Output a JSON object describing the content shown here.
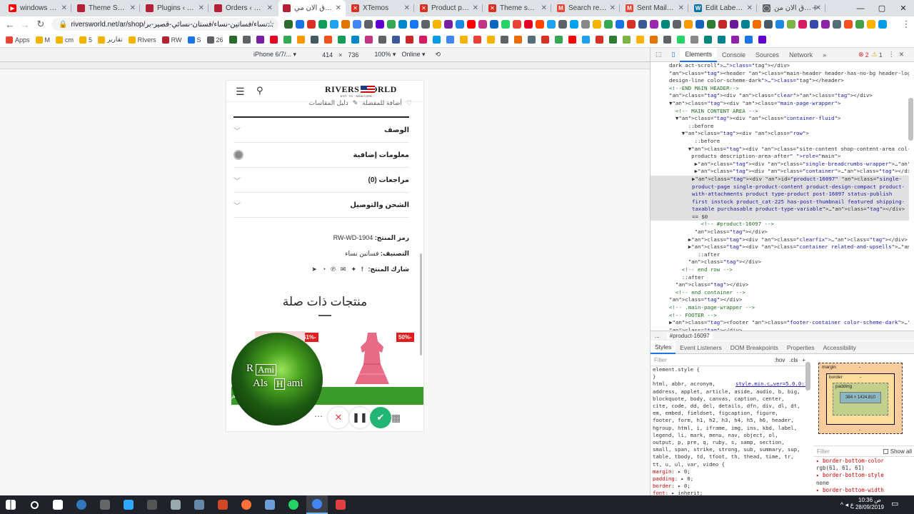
{
  "browser": {
    "tabs": [
      {
        "title": "windows 10.m",
        "color": "#ff0000",
        "glyph": "▶"
      },
      {
        "title": "Theme Setting",
        "color": "#b22234",
        "glyph": ""
      },
      {
        "title": "Plugins ‹ روزرك",
        "color": "#b22234",
        "glyph": ""
      },
      {
        "title": "Orders ‹ روزرك",
        "color": "#b22234",
        "glyph": ""
      },
      {
        "title": "تسوق الان مي",
        "color": "#b22234",
        "glyph": ""
      },
      {
        "title": "XTemos",
        "color": "#d93025",
        "glyph": "✕"
      },
      {
        "title": "Product page",
        "color": "#d93025",
        "glyph": "✕"
      },
      {
        "title": "Theme setting",
        "color": "#d93025",
        "glyph": "✕"
      },
      {
        "title": "Search results",
        "color": "#ea4335",
        "glyph": "M"
      },
      {
        "title": "Sent Mail - ra",
        "color": "#ea4335",
        "glyph": "M"
      },
      {
        "title": "Edit Label ‹ ك",
        "color": "#0073aa",
        "glyph": "W"
      },
      {
        "title": "تسوق الان من",
        "color": "#5f6368",
        "glyph": "◯"
      }
    ],
    "url": "riversworld.net/ar/shop/نساء/فساتين-نساء/فستان-نسائي-قصير-بر...",
    "bookmarks": [
      "Apps",
      "M",
      "cm",
      "5",
      "تقارير",
      "RIvers",
      "RW",
      "S",
      "26"
    ]
  },
  "devtools_bar": {
    "device": "iPhone 6/7/... ▾",
    "width": "414",
    "times": "×",
    "height": "736",
    "zoom": "100% ▾",
    "network": "Online ▾"
  },
  "devtools": {
    "tabs": [
      "Elements",
      "Console",
      "Sources",
      "Network",
      "»"
    ],
    "errors": "2",
    "warnings": "1",
    "dom_lines": [
      "dark act-scroll\">…</div>",
      "<header class=\"main-header header-has-no-bg header-logo-center icons-",
      "design-line color-scheme-dark\">…</header>",
      "<!--END MAIN HEADER-->",
      "<div class=\"clear\"></div>",
      "▼<div class=\"main-page-wrapper\">",
      "  <!-- MAIN CONTENT AREA -->",
      "  ▼<div class=\"container-fluid\">",
      "      ::before",
      "    ▼<div class=\"row\">",
      "        ::before",
      "      ▼<div class=\"site-content shop-content-area col-sm-12 content-with-",
      "       products description-area-after\" role=\"main\">",
      "        ▶<div class=\"single-breadcrumbs-wrapper\">…</div>",
      "        ▶<div class=\"container\">…</div>",
      "        ▶<div id=\"product-16097\" class=\"single-product-page single-product-content product-design-compact product-with-attachments product type-product post-16097 status-publish first instock product_cat-225 has-post-thumbnail featured shipping-taxable purchasable product-type-variable\">…</div> == $0",
      "          <!-- #product-16097 -->",
      "        </div>",
      "      ▶<div class=\"clearfix\">…</div>",
      "      ▶<div class=\"container related-and-upsells\">…</div>",
      "         ::after",
      "      </div>",
      "    <!-- end row -->",
      "    ::after",
      "  </div>",
      "  <!-- end container -->",
      "</div>",
      "<!-- .main-page-wrapper -->",
      "<!-- FOOTER -->",
      "▶<footer class=\"footer-container color-scheme-dark\">…</footer>",
      "</div>"
    ],
    "breadcrumb_dots": "...",
    "breadcrumb": "#product-16097",
    "styles_tabs": [
      "Styles",
      "Event Listeners",
      "DOM Breakpoints",
      "Properties",
      "Accessibility"
    ],
    "filter_placeholder": "Filter",
    "hov": ":hov",
    "cls": ".cls",
    "plus": "+",
    "style_lines": [
      "element.style {",
      "}",
      "html, abbr, acronym,",
      "address, applet, article, aside, audio, b, big,",
      "blockquote, body, canvas, caption, center,",
      "cite, code, dd, del, details, dfn, div, dl, dt,",
      "em, embed, fieldset, figcaption, figure,",
      "footer, form, h1, h2, h3, h4, h5, h6, header,",
      "hgroup, html, i, iframe, img, ins, kbd, label,",
      "legend, li, mark, menu, nav, object, ol,",
      "output, p, pre, q, ruby, s, samp, section,",
      "small, span, strike, strong, sub, summary, sup,",
      "table, tbody, td, tfoot, th, thead, time, tr,",
      "tt, u, ul, var, video {",
      "  margin: ▸ 0;",
      "  padding: ▸ 0;",
      "  border: ▸ 0;",
      "  font: ▸ inherit;"
    ],
    "stylesheet_link": "style.min.c…ver=5.0.0:1",
    "box_model": {
      "margin": "margin",
      "border": "border",
      "padding": "padding",
      "dash": "-",
      "content": "384 × 1424.810"
    },
    "filter2": "Filter",
    "show_all": "Show all",
    "computed": [
      "▸ border-bottom-color",
      "  rgb(61, 61, 61)",
      "▸ border-bottom-style",
      "  none",
      "▸ border-bottom-width"
    ]
  },
  "phone": {
    "logo": "RIVERS WORLD",
    "logo_sub": "EST. TO · NEWYORK",
    "wishlist": "أضافة للمفضلة",
    "size_guide": "دليل المقاسات",
    "accordion": [
      "الوصف",
      "معلومات إضافية",
      "مراجعات (0)",
      "الشحن والتوصيل"
    ],
    "sku_label": "رمز المنتج:",
    "sku_value": "RW-WD-1904",
    "category_label": "التصنيف:",
    "category_value": "فساتين نساء",
    "share_label": "شارك المنتج:",
    "related_title": "منتجات ذات صلة",
    "discount1": "61%-",
    "discount2": "50%-",
    "cart_bar": "حدد احد الم"
  },
  "overlay": {
    "line1": "R",
    "box1": "Ami",
    "line2": "Als",
    "box2": "H",
    "line3": "ami"
  },
  "taskbar": {
    "time": "10:36 ص",
    "date": "28/09/2019",
    "tray": "^ ◂ ع"
  }
}
